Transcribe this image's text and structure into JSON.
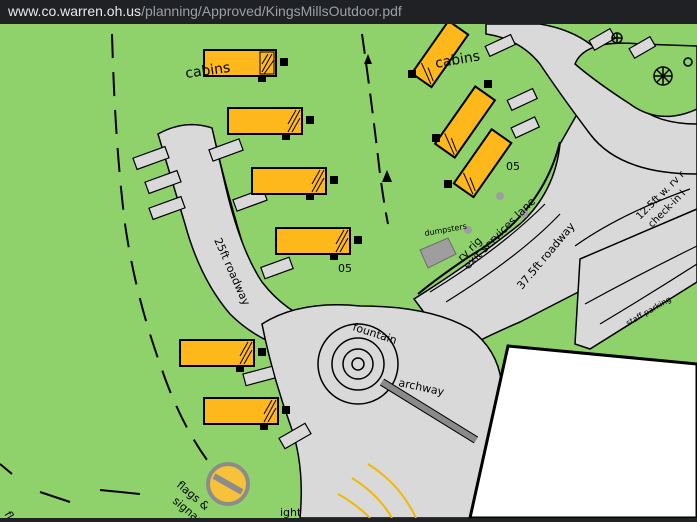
{
  "browser": {
    "url_host": "www.co.warren.oh.us",
    "url_path": "/planning/Approved/KingsMillsOutdoor.pdf"
  },
  "map": {
    "colors": {
      "grass": "#8fd16a",
      "road": "#d9d9d9",
      "cabin": "#ffb81c",
      "outline": "#000000",
      "arch": "#8a8a8a",
      "yellow_lines": "#f2b705",
      "sign_fill": "#f7c23a",
      "sign_ring": "#8c8c8c"
    },
    "labels": {
      "cabins_left": "cabins",
      "cabins_right": "cabins",
      "road_25": "25ft roadway",
      "road_375": "37.5ft roadway",
      "rv_rig": "rv rig",
      "exit_services": "exit services lane",
      "dumpsters": "dumpsters",
      "fountain": "fountain",
      "archway": "archway",
      "staff_parking": "staff parking",
      "rv_check_top": "12.5ft w. rv r",
      "rv_check_bottom": "check-in l",
      "num_05_center": "05",
      "num_05_right": "05",
      "flags_signage_1": "flags &",
      "flags_signage_2": "signage",
      "partial_bottom": "ight",
      "partial_left": "fla"
    }
  }
}
